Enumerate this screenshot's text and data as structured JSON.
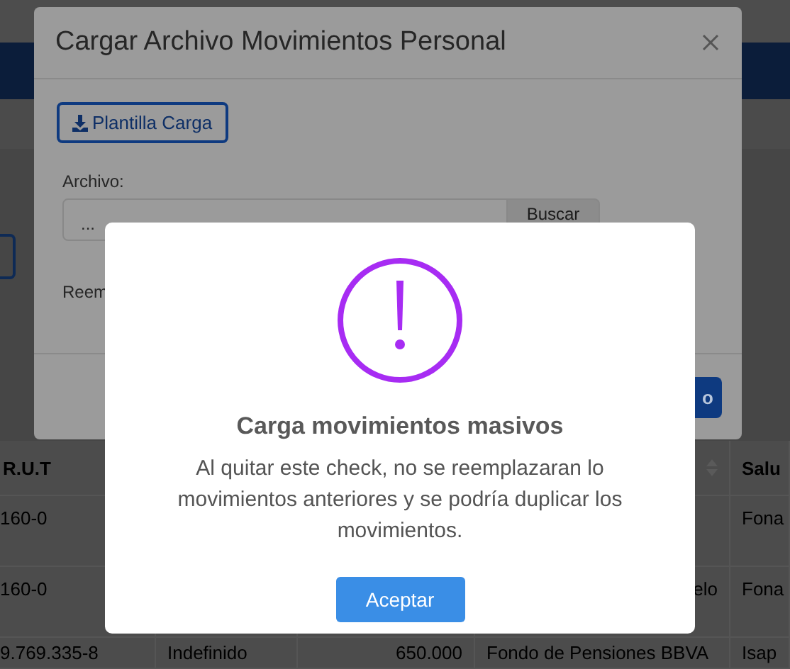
{
  "table": {
    "columns": [
      {
        "label": "R.U.T"
      },
      {},
      {},
      {
        "sortable": true
      },
      {
        "label": "Salu"
      }
    ],
    "rows": [
      {
        "kind": "plain",
        "cells": [
          "160-0",
          "",
          "",
          "",
          "Fona"
        ]
      },
      {
        "kind": "wrapped",
        "cells": [
          "160-0",
          "",
          "",
          "elo",
          "Fona"
        ]
      },
      {
        "kind": "plain",
        "cells": [
          "9.769.335-8",
          "Indefinido",
          "650.000",
          "Fondo de Pensiones BBVA",
          "Isap"
        ]
      }
    ]
  },
  "upload_dialog": {
    "title": "Cargar Archivo Movimientos Personal",
    "template_button": "Plantilla Carga",
    "file_label": "Archivo:",
    "file_value": "...",
    "browse_button": "Buscar",
    "replace_label": "Reem",
    "submit_button": "o"
  },
  "alert": {
    "title": "Carga movimientos masivos",
    "message": "Al quitar este check, no se reemplazaran lo movimientos anteriores y se podría duplicar los movimientos.",
    "button": "Aceptar"
  }
}
